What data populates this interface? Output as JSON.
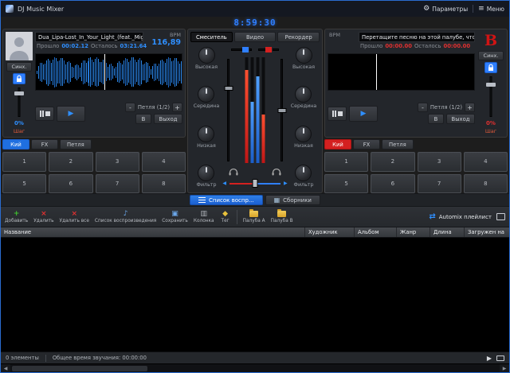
{
  "window": {
    "title": "DJ Music Mixer",
    "params_label": "Параметры",
    "menu_label": "Меню",
    "clock": "8:59:30"
  },
  "icons": {
    "gear": "⚙",
    "menu": "≡",
    "play": "▶",
    "grid": "▦",
    "note": "♪",
    "column": "▥",
    "save": "▣",
    "tag": "◆",
    "cross": "×",
    "plus": "+",
    "shuffle": "⇄",
    "left": "◀",
    "right": "▶"
  },
  "colors": {
    "deck_a_accent": "#2f8fff",
    "deck_b_accent": "#e02020"
  },
  "deckA": {
    "track_title": "Dua_Lipa-Lost_In_Your_Light_(feat._Miguel)",
    "bpm_label": "BPM",
    "bpm_value": "116,89",
    "elapsed_label": "Прошло",
    "elapsed_value": "00:02.12",
    "remaining_label": "Осталось",
    "remaining_value": "03:21.64",
    "sync_label": "Синх.",
    "pitch_value": "0%",
    "pitch_step_label": "Шаг",
    "loop_minus": "-",
    "loop_label": "Петля (1/2)",
    "loop_plus": "+",
    "loop_in": "В",
    "loop_out": "Выход",
    "cue_tab": "Кий",
    "fx_tab": "FX",
    "loop_tab": "Петля",
    "pads": [
      "1",
      "2",
      "3",
      "4",
      "5",
      "6",
      "7",
      "8"
    ]
  },
  "deckB": {
    "drop_hint": "Перетащите песню на этой палубе, что...",
    "deck_letter": "B",
    "bpm_label": "BPM",
    "bpm_value": "",
    "elapsed_label": "Прошло",
    "elapsed_value": "00:00.00",
    "remaining_label": "Осталось",
    "remaining_value": "00:00.00",
    "sync_label": "Синх.",
    "pitch_value": "0%",
    "pitch_step_label": "Шаг",
    "loop_minus": "-",
    "loop_label": "Петля (1/2)",
    "loop_plus": "+",
    "loop_in": "В",
    "loop_out": "Выход",
    "cue_tab": "Кий",
    "fx_tab": "FX",
    "loop_tab": "Петля",
    "pads": [
      "1",
      "2",
      "3",
      "4",
      "5",
      "6",
      "7",
      "8"
    ]
  },
  "mixer": {
    "tabs": [
      "Смеситель",
      "Видео",
      "Рекордер"
    ],
    "knobs": [
      "Высокая",
      "Середина",
      "Низкая",
      "Фильтр"
    ]
  },
  "playlist": {
    "tab_playlist": "Список воспр...",
    "tab_collections": "Сборники",
    "toolbar": [
      "Добавить",
      "Удалить",
      "Удалить все",
      "Список воспроизведения",
      "Сохранить",
      "Колонка",
      "Тег",
      "Палуба A",
      "Палуба B"
    ],
    "automix_label": "Automix плейлист",
    "columns": [
      "Название",
      "Художник",
      "Альбом",
      "Жанр",
      "Длина",
      "Загружен на"
    ]
  },
  "statusbar": {
    "items_count": "0 элементы",
    "total_time": "Общее время звучания: 00:00:00"
  }
}
